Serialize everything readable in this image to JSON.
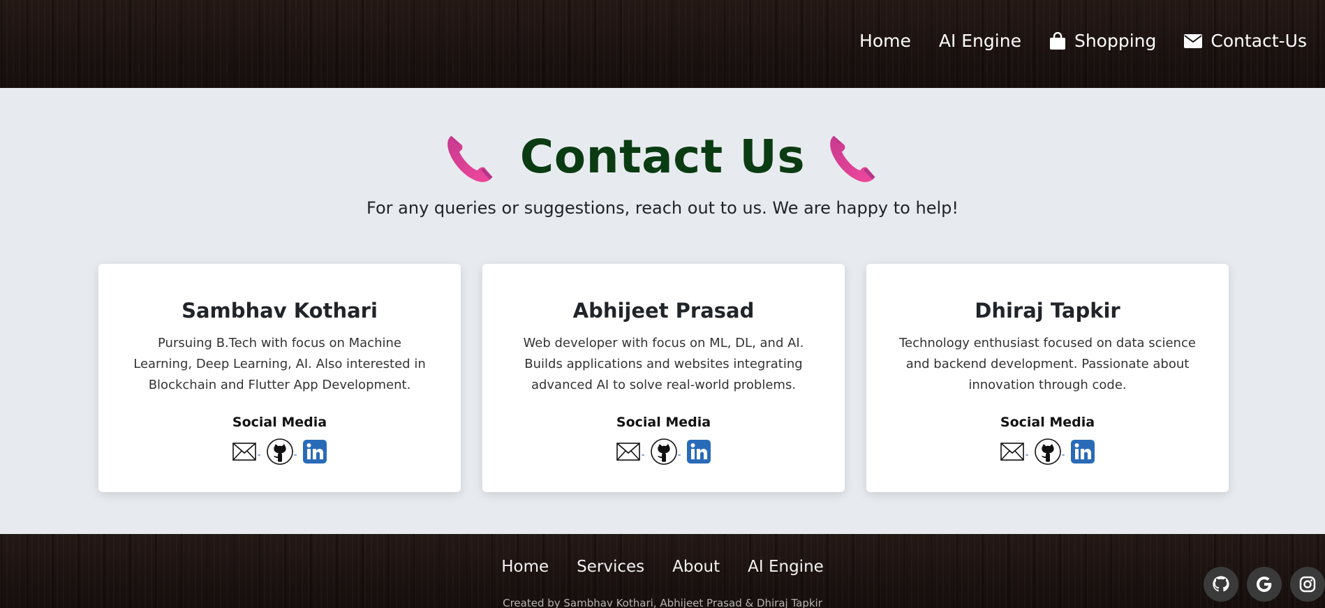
{
  "nav": {
    "items": [
      {
        "label": "Home",
        "icon": ""
      },
      {
        "label": "AI Engine",
        "icon": ""
      },
      {
        "label": "Shopping",
        "icon": "shopping-bag-icon"
      },
      {
        "label": "Contact-Us",
        "icon": "envelope-icon"
      }
    ]
  },
  "hero": {
    "title": "Contact Us",
    "subtitle": "For any queries or suggestions, reach out to us. We are happy to help!",
    "icon": "telephone-receiver-icon"
  },
  "cards": [
    {
      "name": "Sambhav Kothari",
      "description": "Pursuing B.Tech with focus on Machine Learning, Deep Learning, AI. Also interested in Blockchain and Flutter App Development.",
      "social_title": "Social Media"
    },
    {
      "name": "Abhijeet Prasad",
      "description": "Web developer with focus on ML, DL, and AI. Builds applications and websites integrating advanced AI to solve real-world problems.",
      "social_title": "Social Media"
    },
    {
      "name": "Dhiraj Tapkir",
      "description": "Technology enthusiast focused on data science and backend development. Passionate about innovation through code.",
      "social_title": "Social Media"
    }
  ],
  "social_icons": [
    "mail-icon",
    "github-icon",
    "linkedin-icon"
  ],
  "footer": {
    "links": [
      "Home",
      "Services",
      "About",
      "AI Engine"
    ],
    "credit": "Created by Sambhav Kothari, Abhijeet Prasad & Dhiraj Tapkir",
    "social_icons": [
      "github-icon",
      "google-icon",
      "instagram-icon"
    ]
  },
  "colors": {
    "title": "#0b3b12",
    "background": "#e7ebef",
    "linkedin": "#2a6bb8",
    "phone": "#e83a8a"
  }
}
